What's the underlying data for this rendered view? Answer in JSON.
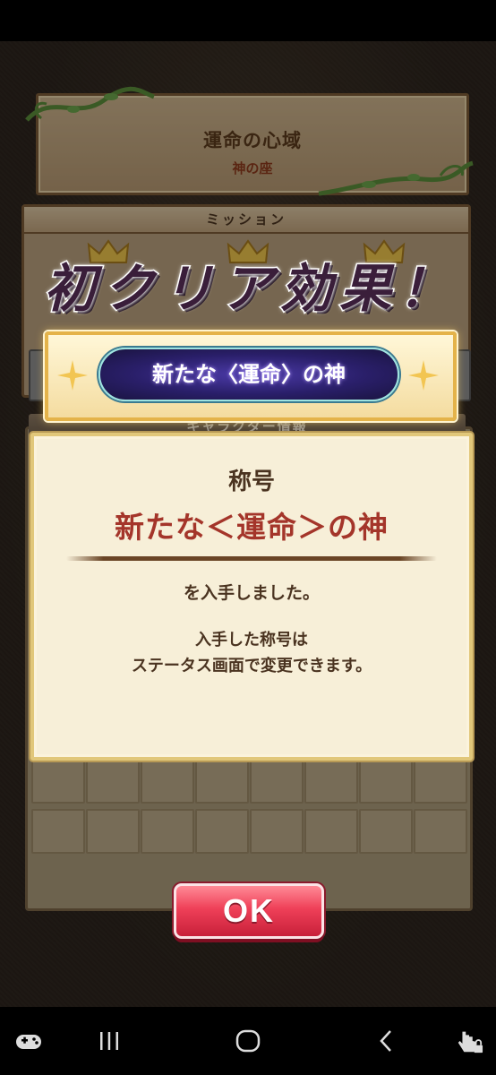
{
  "location": {
    "title": "運命の心域",
    "subtitle": "神の座"
  },
  "mission": {
    "header": "ミッション"
  },
  "character": {
    "header": "キャラクター情報"
  },
  "headline": "初クリア効果！",
  "banner": {
    "title_name": "新たな〈運命〉の神"
  },
  "dialog": {
    "label": "称号",
    "title_name": "新たな＜運命＞の神",
    "obtained": "を入手しました。",
    "note_line1": "入手した称号は",
    "note_line2": "ステータス画面で変更できます。"
  },
  "ok_button": "OK",
  "navbar": {
    "icons": [
      "gamepad-icon",
      "recent-apps-icon",
      "home-icon",
      "back-icon",
      "touch-lock-icon"
    ]
  },
  "colors": {
    "ok": "#ef4058",
    "title_red": "#a4352a",
    "banner_gold": "#e4b34a"
  }
}
